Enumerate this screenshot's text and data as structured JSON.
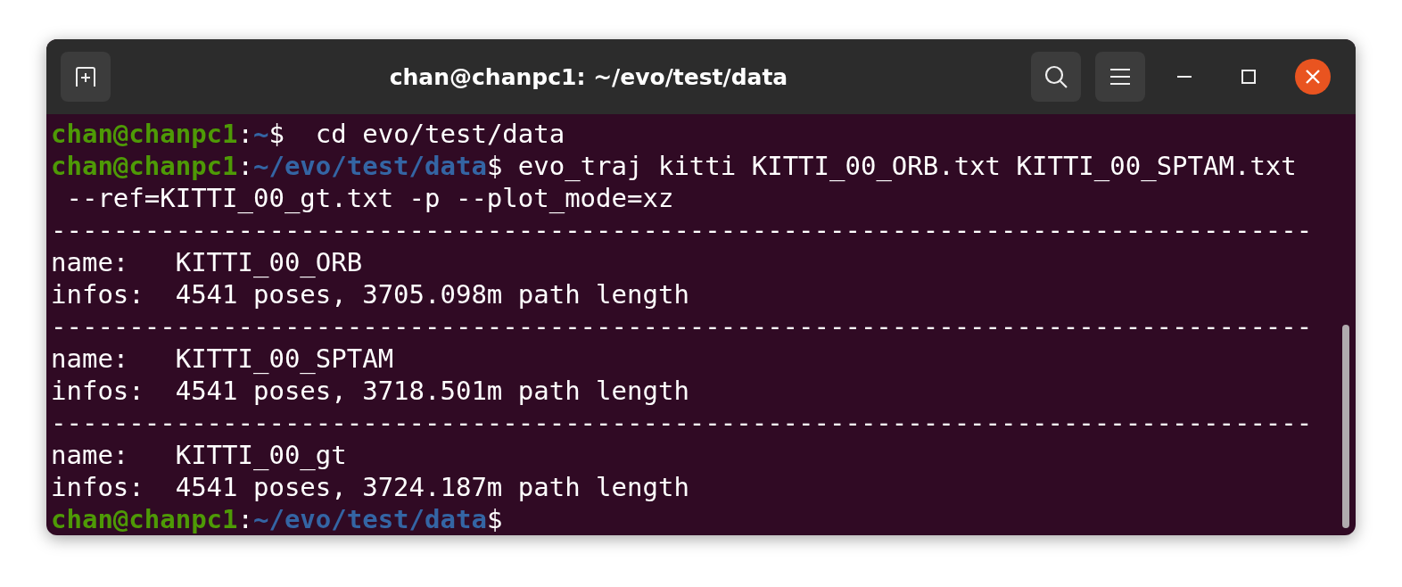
{
  "window": {
    "title": "chan@chanpc1: ~/evo/test/data"
  },
  "lines": [
    {
      "kind": "prompt",
      "user_host": "chan@chanpc1",
      "colon": ":",
      "path": "~",
      "dollar": "$",
      "command": "  cd evo/test/data"
    },
    {
      "kind": "prompt",
      "user_host": "chan@chanpc1",
      "colon": ":",
      "path": "~/evo/test/data",
      "dollar": "$",
      "command": " evo_traj kitti KITTI_00_ORB.txt KITTI_00_SPTAM.txt"
    },
    {
      "kind": "output",
      "text": " --ref=KITTI_00_gt.txt -p --plot_mode=xz"
    },
    {
      "kind": "rule",
      "text": "---------------------------------------------------------------------------------"
    },
    {
      "kind": "output",
      "text": "name:   KITTI_00_ORB"
    },
    {
      "kind": "output",
      "text": "infos:  4541 poses, 3705.098m path length"
    },
    {
      "kind": "rule",
      "text": "---------------------------------------------------------------------------------"
    },
    {
      "kind": "output",
      "text": "name:   KITTI_00_SPTAM"
    },
    {
      "kind": "output",
      "text": "infos:  4541 poses, 3718.501m path length"
    },
    {
      "kind": "rule",
      "text": "---------------------------------------------------------------------------------"
    },
    {
      "kind": "output",
      "text": "name:   KITTI_00_gt"
    },
    {
      "kind": "output",
      "text": "infos:  4541 poses, 3724.187m path length"
    },
    {
      "kind": "prompt",
      "user_host": "chan@chanpc1",
      "colon": ":",
      "path": "~/evo/test/data",
      "dollar": "$"
    }
  ]
}
